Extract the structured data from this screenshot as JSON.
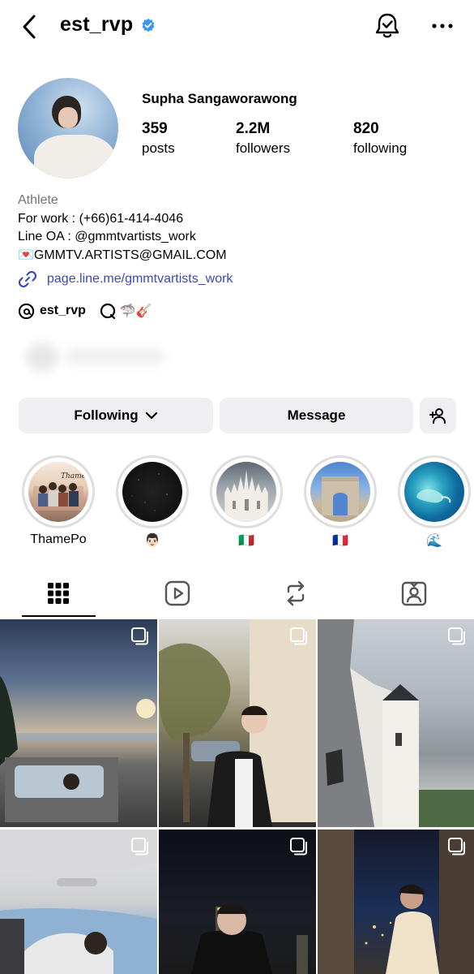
{
  "header": {
    "username": "est_rvp",
    "icons": [
      "back-chevron-icon",
      "verified-badge-icon",
      "notification-bell-icon",
      "more-options-icon"
    ]
  },
  "profile": {
    "full_name": "Supha Sangaworawong",
    "stats": [
      {
        "value": "359",
        "label": "posts"
      },
      {
        "value": "2.2M",
        "label": "followers"
      },
      {
        "value": "820",
        "label": "following"
      }
    ],
    "category": "Athlete",
    "bio_lines": [
      "For work : (+66)61-414-4046",
      "Line OA : @gmmtvartists_work",
      "💌GMMTV.ARTISTS@GMAIL.COM"
    ],
    "link": "page.line.me/gmmtvartists_work",
    "threads_handle": "est_rvp",
    "threads_emojis": "🦈🎸"
  },
  "buttons": {
    "following": "Following",
    "message": "Message"
  },
  "highlights": [
    {
      "label": "ThamePo"
    },
    {
      "label": "👨🏻"
    },
    {
      "label": "🇮🇹"
    },
    {
      "label": "🇫🇷"
    },
    {
      "label": "🌊"
    }
  ],
  "tabs": [
    "posts-grid-icon",
    "reels-icon",
    "reposts-icon",
    "tagged-icon"
  ],
  "colors": {
    "link": "#3a4ab6",
    "verified": "#3897f0",
    "button_bg": "#efeff1",
    "secondary_text": "#737373"
  }
}
